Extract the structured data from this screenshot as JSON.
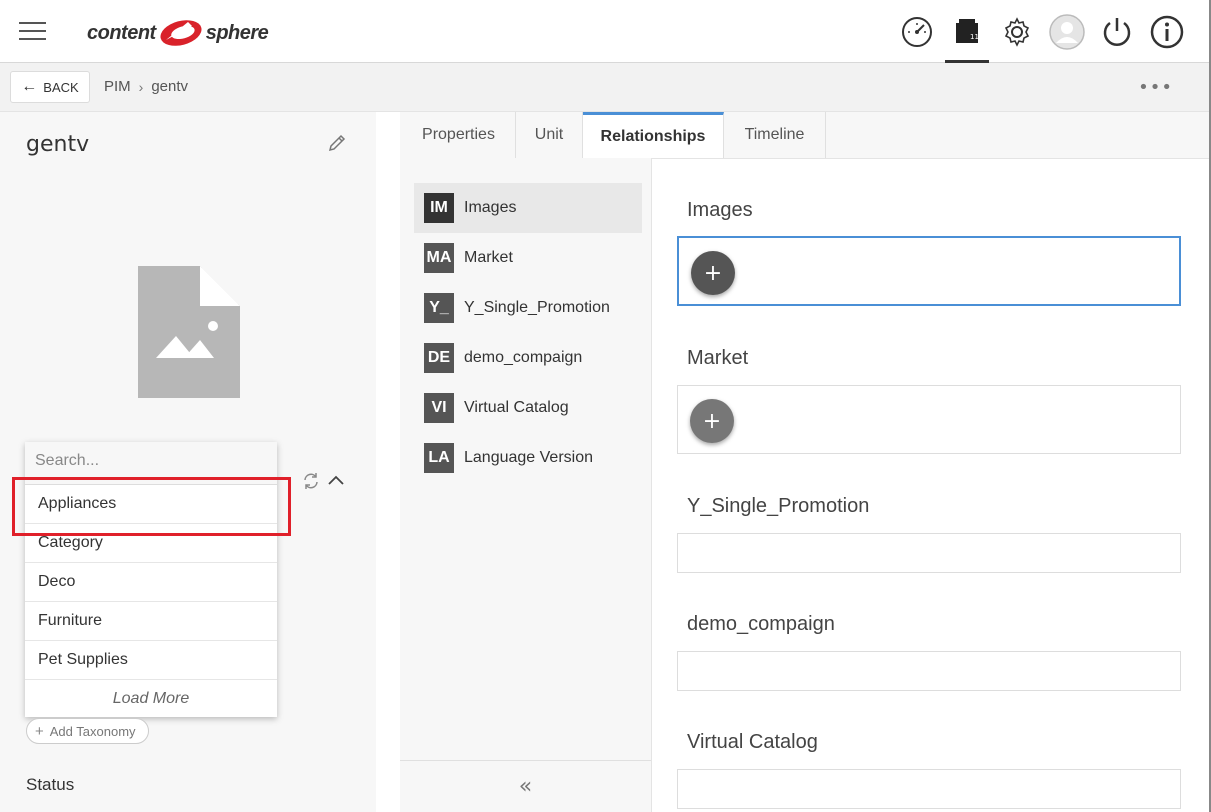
{
  "header": {
    "logo_left": "content",
    "logo_right": "sphere",
    "icons": [
      "dashboard-icon",
      "product-box-icon",
      "settings-gear-icon",
      "user-avatar-icon",
      "power-icon",
      "info-icon"
    ],
    "box_badge": "11"
  },
  "crumbbar": {
    "back_label": "BACK",
    "crumbs": [
      "PIM",
      "gentv"
    ]
  },
  "item": {
    "title": "gentv"
  },
  "taxonomy": {
    "search_placeholder": "Search...",
    "options": [
      "Appliances",
      "Category",
      "Deco",
      "Furniture",
      "Pet Supplies"
    ],
    "load_more": "Load More",
    "add_label": "Add Taxonomy",
    "status_label": "Status"
  },
  "tabs": [
    "Properties",
    "Unit",
    "Relationships",
    "Timeline"
  ],
  "relationships": [
    {
      "abbr": "IM",
      "label": "Images"
    },
    {
      "abbr": "MA",
      "label": "Market"
    },
    {
      "abbr": "Y_",
      "label": "Y_Single_Promotion"
    },
    {
      "abbr": "DE",
      "label": "demo_compaign"
    },
    {
      "abbr": "VI",
      "label": "Virtual Catalog"
    },
    {
      "abbr": "LA",
      "label": "Language Version"
    }
  ],
  "sections": [
    "Images",
    "Market",
    "Y_Single_Promotion",
    "demo_compaign",
    "Virtual Catalog"
  ],
  "colors": {
    "accent": "#4a8fd6",
    "highlight": "#e0202a",
    "logo_red": "#d9222a"
  }
}
